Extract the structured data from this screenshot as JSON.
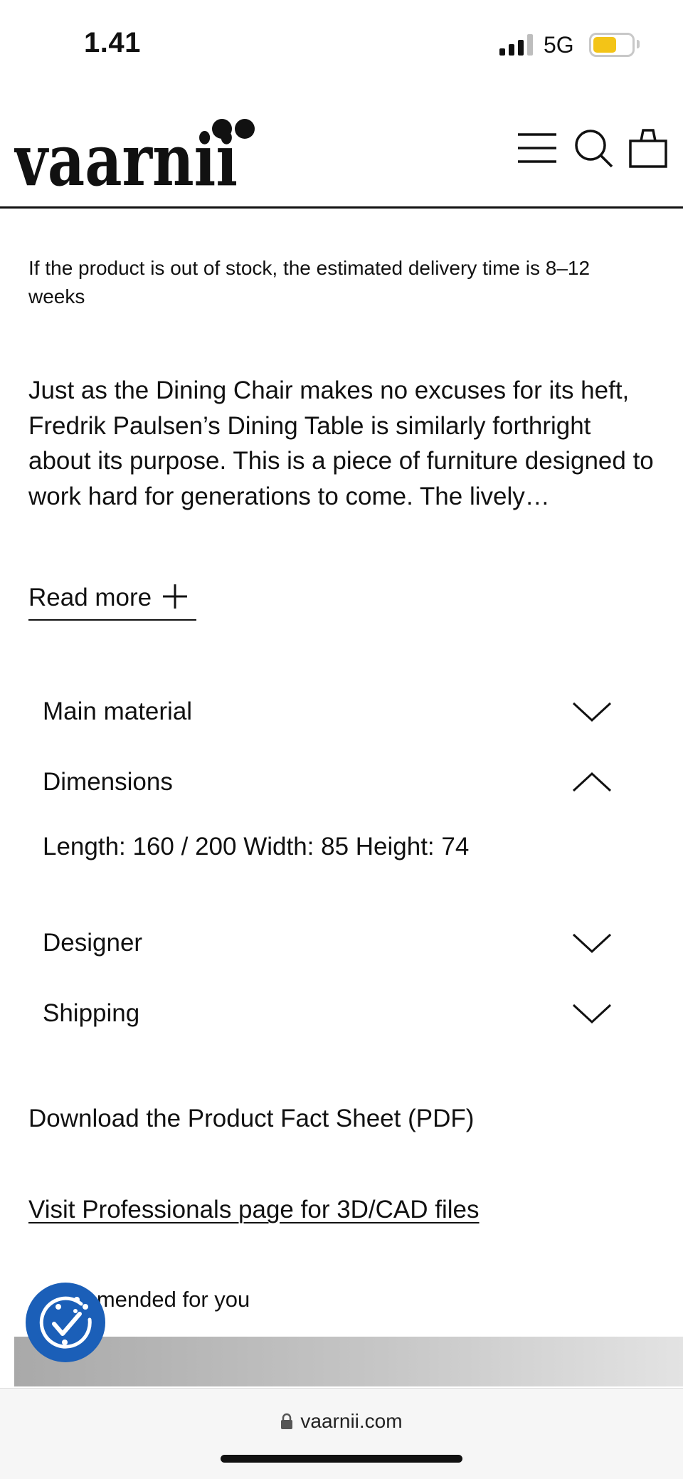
{
  "status_bar": {
    "time": "1.41",
    "network": "5G"
  },
  "header": {
    "logo": "vaarnii",
    "icons": [
      "menu-icon",
      "search-icon",
      "bag-icon"
    ]
  },
  "delivery_note": "If the product is out of stock, the estimated delivery time is 8–12 weeks",
  "description": "Just as the Dining Chair makes no excuses for its heft, Fredrik Paulsen’s Dining Table is similarly forthright about its purpose. This is a piece of furniture designed to work hard for generations to come. The lively…",
  "read_more": {
    "label": "Read more"
  },
  "accordion": {
    "main_material": "Main material",
    "dimensions": "Dimensions",
    "dimensions_content": "Length: 160 / 200 Width: 85 Height: 74",
    "designer": "Designer",
    "shipping": "Shipping"
  },
  "links": {
    "pdf": "Download the Product Fact Sheet (PDF)",
    "professionals": "Visit Professionals page for 3D/CAD files"
  },
  "recommended_label": "mmended for you",
  "browser": {
    "url": "vaarnii.com"
  },
  "colors": {
    "cookie_badge": "#1b5fb8",
    "battery": "#f3c417",
    "text": "#111111"
  }
}
